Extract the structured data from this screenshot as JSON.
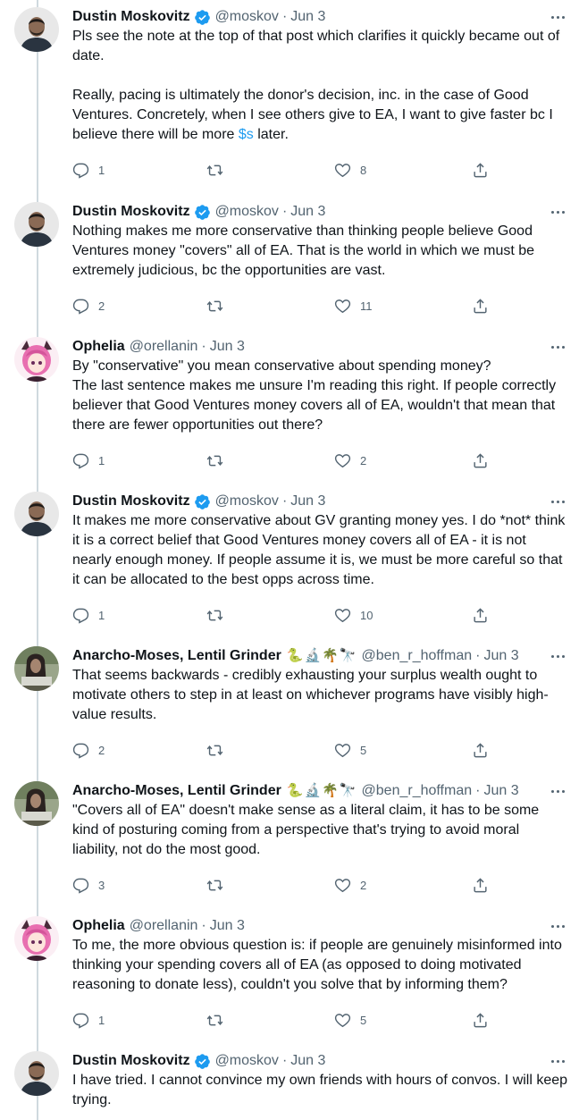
{
  "tweets": [
    {
      "author": "Dustin Moskovitz",
      "handle": "@moskov",
      "date": "Jun 3",
      "verified": true,
      "avatar": "dustin",
      "text_before": "Pls see the note at the top of that post which clarifies it quickly became out of date.\n\nReally, pacing is ultimately the donor's decision, inc. in the case of Good Ventures. Concretely, when I see others give to EA, I want to give faster bc I believe there will be more ",
      "link": "$s",
      "text_after": " later.",
      "replies": "1",
      "retweets": "",
      "likes": "8"
    },
    {
      "author": "Dustin Moskovitz",
      "handle": "@moskov",
      "date": "Jun 3",
      "verified": true,
      "avatar": "dustin",
      "text": "Nothing makes me more conservative than thinking people believe Good Ventures money \"covers\" all of EA. That is the world in which we must be extremely judicious, bc the opportunities are vast.",
      "replies": "2",
      "retweets": "",
      "likes": "11"
    },
    {
      "author": "Ophelia",
      "handle": "@orellanin",
      "date": "Jun 3",
      "verified": false,
      "avatar": "ophelia",
      "text": "By \"conservative\" you mean conservative about spending money?\nThe last sentence makes me unsure I'm reading this right. If people correctly believer that Good Ventures money covers all of EA, wouldn't that mean that there are fewer opportunities out there?",
      "replies": "1",
      "retweets": "",
      "likes": "2"
    },
    {
      "author": "Dustin Moskovitz",
      "handle": "@moskov",
      "date": "Jun 3",
      "verified": true,
      "avatar": "dustin",
      "text": "It makes me more conservative about GV granting money yes. I do *not* think it is a correct belief that Good Ventures money covers all of EA - it is not nearly enough money. If people assume it is, we must be more careful so that it can be allocated to the best opps across time.",
      "replies": "1",
      "retweets": "",
      "likes": "10"
    },
    {
      "author": "Anarcho-Moses, Lentil Grinder",
      "handle": "@ben_r_hoffman",
      "date": "Jun 3",
      "verified": false,
      "emojis": "🐍🔬🌴🔭",
      "avatar": "ben",
      "text": "That seems backwards - credibly exhausting your surplus wealth ought to motivate others to step in at least on whichever programs have visibly high-value results.",
      "replies": "2",
      "retweets": "",
      "likes": "5"
    },
    {
      "author": "Anarcho-Moses, Lentil Grinder",
      "handle": "@ben_r_hoffman",
      "date": "Jun 3",
      "verified": false,
      "emojis": "🐍🔬🌴🔭",
      "avatar": "ben",
      "text": "\"Covers all of EA\" doesn't make sense as a literal claim, it has to be some kind of posturing coming from a perspective that's trying to avoid moral liability, not do the most good.",
      "replies": "3",
      "retweets": "",
      "likes": "2"
    },
    {
      "author": "Ophelia",
      "handle": "@orellanin",
      "date": "Jun 3",
      "verified": false,
      "avatar": "ophelia",
      "text": "To me, the more obvious question is: if people are genuinely misinformed into thinking your spending covers all of EA (as opposed to doing motivated reasoning to donate less), couldn't you solve that by informing them?",
      "replies": "1",
      "retweets": "",
      "likes": "5"
    },
    {
      "author": "Dustin Moskovitz",
      "handle": "@moskov",
      "date": "Jun 3",
      "verified": true,
      "avatar": "dustin",
      "text": "I have tried. I cannot convince my own friends with hours of convos. I will keep trying."
    }
  ],
  "separator": "·",
  "icons": {
    "reply": "reply-icon",
    "retweet": "retweet-icon",
    "like": "heart-icon",
    "share": "share-icon",
    "more": "more-icon",
    "verified": "verified-badge-icon"
  },
  "colors": {
    "text": "#0f1419",
    "secondary": "#536471",
    "link": "#1d9bf0",
    "verified": "#1d9bf0",
    "thread_line": "#cfd9de"
  }
}
